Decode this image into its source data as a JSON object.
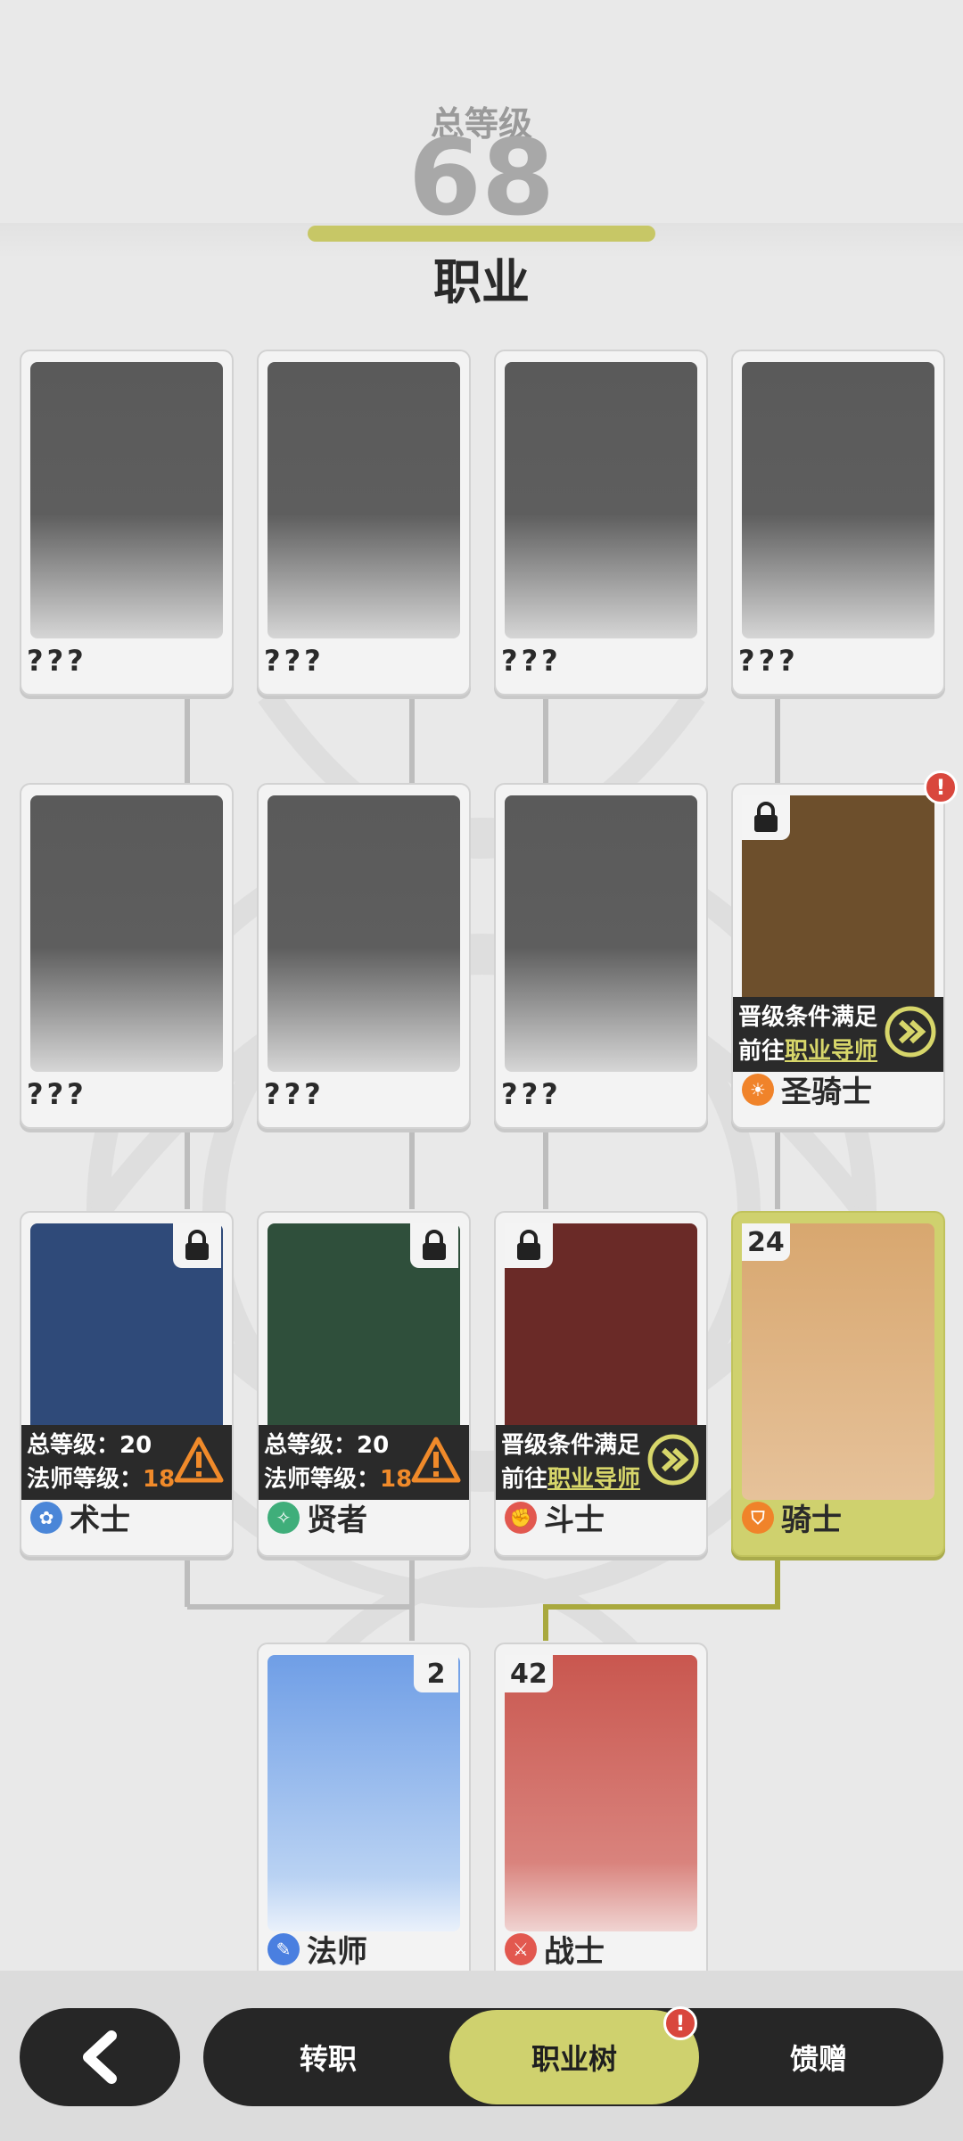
{
  "header": {
    "total_level_label": "总等级",
    "total_level_value": "68",
    "title": "职业"
  },
  "cards": {
    "r1c1": {
      "name": "???"
    },
    "r1c2": {
      "name": "???"
    },
    "r1c3": {
      "name": "???"
    },
    "r1c4": {
      "name": "???"
    },
    "r2c1": {
      "name": "???"
    },
    "r2c2": {
      "name": "???"
    },
    "r2c3": {
      "name": "???"
    },
    "paladin": {
      "name": "圣骑士",
      "cond_line1": "晋级条件满足",
      "cond_line2_prefix": "前往",
      "cond_line2_link": "职业导师",
      "alert": "!"
    },
    "warlock": {
      "name": "术士",
      "req1_label": "总等级：20",
      "req2_label": "法师等级：",
      "req2_current": "18"
    },
    "sage": {
      "name": "贤者",
      "req1_label": "总等级：20",
      "req2_label": "法师等级：",
      "req2_current": "18"
    },
    "fighter": {
      "name": "斗士",
      "cond_line1": "晋级条件满足",
      "cond_line2_prefix": "前往",
      "cond_line2_link": "职业导师"
    },
    "knight": {
      "name": "骑士",
      "level": "24"
    },
    "mage": {
      "name": "法师",
      "level": "2"
    },
    "warrior": {
      "name": "战士",
      "level": "42"
    }
  },
  "colors": {
    "accent": "#cfd16e",
    "alert": "#d9473d",
    "dark": "#262626",
    "warlock_bg": "#2f4a79",
    "sage_bg": "#2f4f3b",
    "fighter_bg": "#6a2a27",
    "paladin_bg": "#6d4f2c",
    "knight_bg": "#d8a76f",
    "mage_bg": "#6f9ee6",
    "warrior_bg": "#c9574f"
  },
  "bottom_nav": {
    "back_icon": "chevron-left-icon",
    "tabs": [
      "转职",
      "职业树",
      "馈赠"
    ],
    "active_tab": "职业树",
    "tab_alert": "!"
  }
}
